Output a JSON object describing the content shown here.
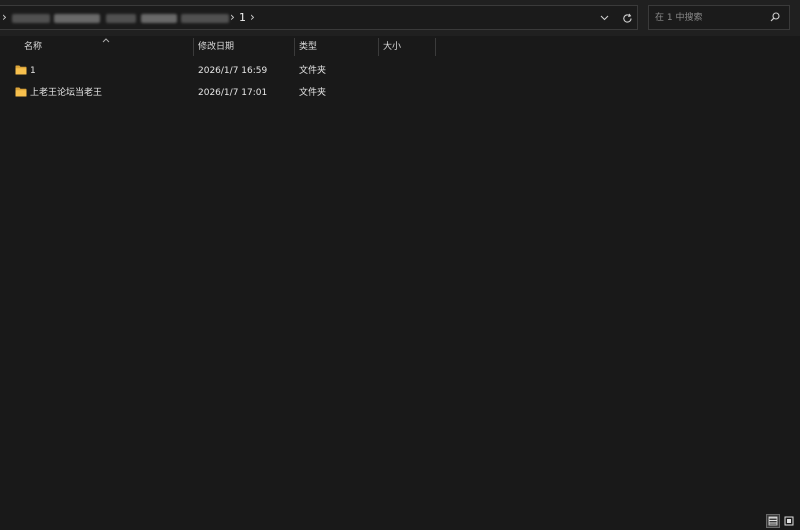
{
  "address_bar": {
    "current_folder": "1",
    "path_redacted": true
  },
  "search": {
    "placeholder": "在 1 中搜索"
  },
  "columns": {
    "name": "名称",
    "date_modified": "修改日期",
    "type": "类型",
    "size": "大小"
  },
  "files": [
    {
      "name": "1",
      "date_modified": "2026/1/7 16:59",
      "type": "文件夹",
      "size": ""
    },
    {
      "name": "上老王论坛当老王",
      "date_modified": "2026/1/7 17:01",
      "type": "文件夹",
      "size": ""
    }
  ],
  "icons": {
    "folder": "folder-icon",
    "refresh": "refresh-icon",
    "dropdown": "chevron-down-icon",
    "search": "search-icon",
    "details_view": "details-view-icon",
    "large_icons_view": "large-icons-view-icon"
  },
  "colors": {
    "background": "#191919",
    "folder": "#f7c04d",
    "text": "#e6e6e6"
  }
}
